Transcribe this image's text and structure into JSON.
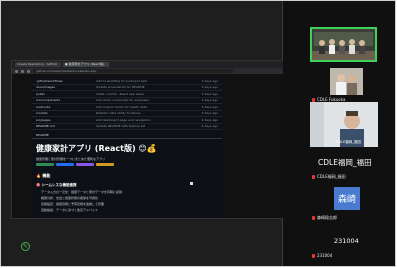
{
  "browser": {
    "tabs": [
      "Create Repository · GitHub",
      "● 健康家計アプリ (React版)"
    ],
    "url": "github.com/example/kenko-kakeibo-app",
    "files": [
      {
        "name": ".github/workflows",
        "message": "Add CI workflow for build and test",
        "when": "2 days ago"
      },
      {
        "name": "docs/images",
        "message": "Update screenshots for README",
        "when": "3 days ago"
      },
      {
        "name": "public",
        "message": "Initial commit - React app setup",
        "when": "3 days ago"
      },
      {
        "name": "src/components",
        "message": "Add chart component for expenses",
        "when": "3 days ago"
      },
      {
        "name": "src/hooks",
        "message": "Add custom hooks for health data",
        "when": "3 days ago"
      },
      {
        "name": "src/utils",
        "message": "Refactor date utility functions",
        "when": "3 days ago"
      },
      {
        "name": "src/pages",
        "message": "Add dashboard page and navigation",
        "when": "4 days ago"
      },
      {
        "name": "README.md",
        "message": "Update README with feature list",
        "when": "4 days ago"
      }
    ],
    "readme_tab": "README",
    "readme_title": "健康家計アプリ (React版) 😊💰",
    "readme_line": "健康管理と家計管理を一つにまとめた便利なアプリ",
    "badge_colors": [
      "#2e8b57",
      "#1f6feb",
      "#8957e5",
      "#d29922"
    ],
    "section_heading": "🔥 機能",
    "subheading": "🎯 シームレスな機能連携",
    "bullets": [
      "データ入力の一元化：健康データと家計データを同時に記録",
      "相関分析：支出と健康状態の関係を可視化",
      "目標設定：健康目標と予算目標を連動して管理",
      "自動提案：データに基づく改善アドバイス"
    ]
  },
  "participants": {
    "tile2_label": "CDLE Fukuoka",
    "tile3_label": "CDLE福岡_福田",
    "cdle_name": "CDLE福岡_福田",
    "cdle_label": "CDLE福岡_福田",
    "morisaki_avatar": "森崎",
    "morisaki_label": "森崎稔志郎",
    "user_name": "231004",
    "user_label": "231004"
  },
  "colors": {
    "accent_green": "#4caf50",
    "mic_muted": "#e53935"
  }
}
